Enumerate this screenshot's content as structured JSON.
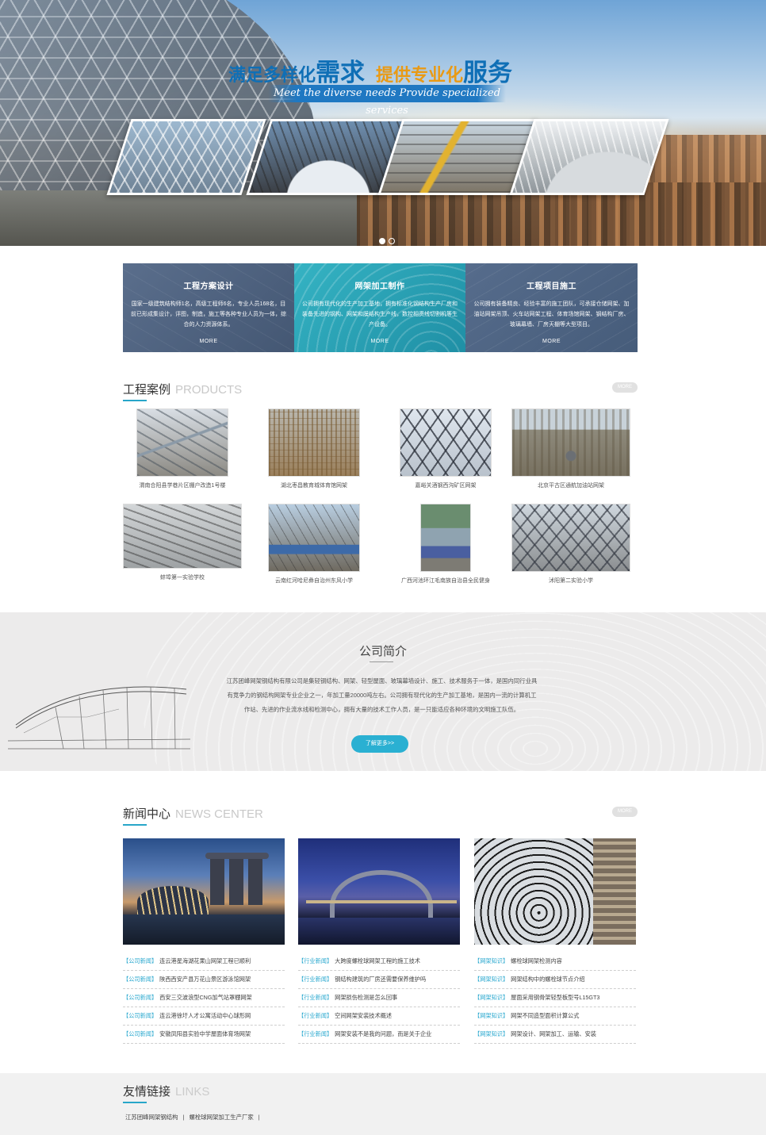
{
  "hero": {
    "title_part1": "满足多样化",
    "title_part1_big": "需求",
    "title_part2": "提供专业化",
    "title_part2_big": "服务",
    "subtitle": "Meet the diverse needs Provide specialized services",
    "slides": 2,
    "active_slide": 1
  },
  "services": [
    {
      "title": "工程方案设计",
      "body": "国家一级建筑结构师1名，高级工程师6名，专业人员168名，目前已形成集设计，评图，制造，施工等各种专业人员为一体，综合的人力资源体系。",
      "more": "MORE"
    },
    {
      "title": "网架加工制作",
      "body": "公司拥有现代化的生产加工基地，拥有标准化钢结构生产厂房和装备先进的钢构、网架和膜结构生产线，数控相贯线切割机等生产设备。",
      "more": "MORE"
    },
    {
      "title": "工程项目施工",
      "body": "公司拥有装备精良、经验丰富的施工团队，可承接仓储网架、加油站网架吊顶、火车站网架工程、体育场馆网架、钢结构厂房、玻璃幕墙、厂房天棚等大型项目。",
      "more": "MORE"
    }
  ],
  "products": {
    "title_cn": "工程案例",
    "title_en": "PRODUCTS",
    "more": "MORE",
    "items": [
      {
        "caption": "渭南合阳县学巷片区棚户改造1号楼"
      },
      {
        "caption": "湖北枣昌教育城体育馆网架"
      },
      {
        "caption": "嘉峪关酒钢西沟矿区网架"
      },
      {
        "caption": "北京平古区通航加油站网架"
      },
      {
        "caption": "蚌埠第一实验学校"
      },
      {
        "caption": "云南红河哈尼彝自治州东风小学"
      },
      {
        "caption": "广西河池环江毛南族自治县全民健身"
      },
      {
        "caption": "沭阳第二实验小学"
      }
    ]
  },
  "about": {
    "title": "公司简介",
    "text": "江苏团峰网架钢结构有限公司是集轻钢结构、网架、轻型屋面、玻璃幕墙设计、施工、技术服务于一体，是国内同行业具有竞争力的钢结构网架专业企业之一，年加工量20000吨左右。公司拥有现代化的生产加工基地，是国内一流的计算机工作站、先进的作业流水线和检测中心，拥有大量的技术工作人员，是一只能适应各种环境的文明施工队伍。",
    "button": "了解更多>>"
  },
  "news": {
    "title_cn": "新闻中心",
    "title_en": "NEWS CENTER",
    "more": "MORE",
    "columns": [
      {
        "items": [
          {
            "tag": "【公司新闻】",
            "text": "连云港星海湖花果山网架工程已顺利"
          },
          {
            "tag": "【公司新闻】",
            "text": "陕西西安产县万花山景区游泳馆网架"
          },
          {
            "tag": "【公司新闻】",
            "text": "西安三交波浪型CNG加气站罩棚网架"
          },
          {
            "tag": "【公司新闻】",
            "text": "连云港徐圩人才公寓活动中心球形网"
          },
          {
            "tag": "【公司新闻】",
            "text": "安徽凤阳县实验中学屋面体育场网架"
          }
        ]
      },
      {
        "items": [
          {
            "tag": "【行业新闻】",
            "text": "大跨度螺栓球网架工程的施工技术"
          },
          {
            "tag": "【行业新闻】",
            "text": "钢结构建筑的厂房还需要保养维护吗"
          },
          {
            "tag": "【行业新闻】",
            "text": "网架损伤检测是怎么回事"
          },
          {
            "tag": "【行业新闻】",
            "text": "空间网架安装技术概述"
          },
          {
            "tag": "【行业新闻】",
            "text": "网架安装不是我的问题，而是关于企业"
          }
        ]
      },
      {
        "items": [
          {
            "tag": "【网架知识】",
            "text": "螺栓球网架检测内容"
          },
          {
            "tag": "【网架知识】",
            "text": "网架结构中的螺栓球节点介绍"
          },
          {
            "tag": "【网架知识】",
            "text": "屋面采用钢骨架轻型板型号L15GT3"
          },
          {
            "tag": "【网架知识】",
            "text": "网架不同造型面积计算公式"
          },
          {
            "tag": "【网架知识】",
            "text": "网架设计、网架加工、运输、安装"
          }
        ]
      }
    ]
  },
  "links": {
    "title_cn": "友情链接",
    "title_en": "LINKS",
    "items": [
      "江苏团峰网架钢结构",
      "螺栓球网架加工生产厂家"
    ],
    "separator": "|"
  },
  "colors": {
    "accent": "#28a6c9",
    "svc1": "#4f6380",
    "svc2": "#2aa6b8",
    "svc3": "#4d6483"
  }
}
